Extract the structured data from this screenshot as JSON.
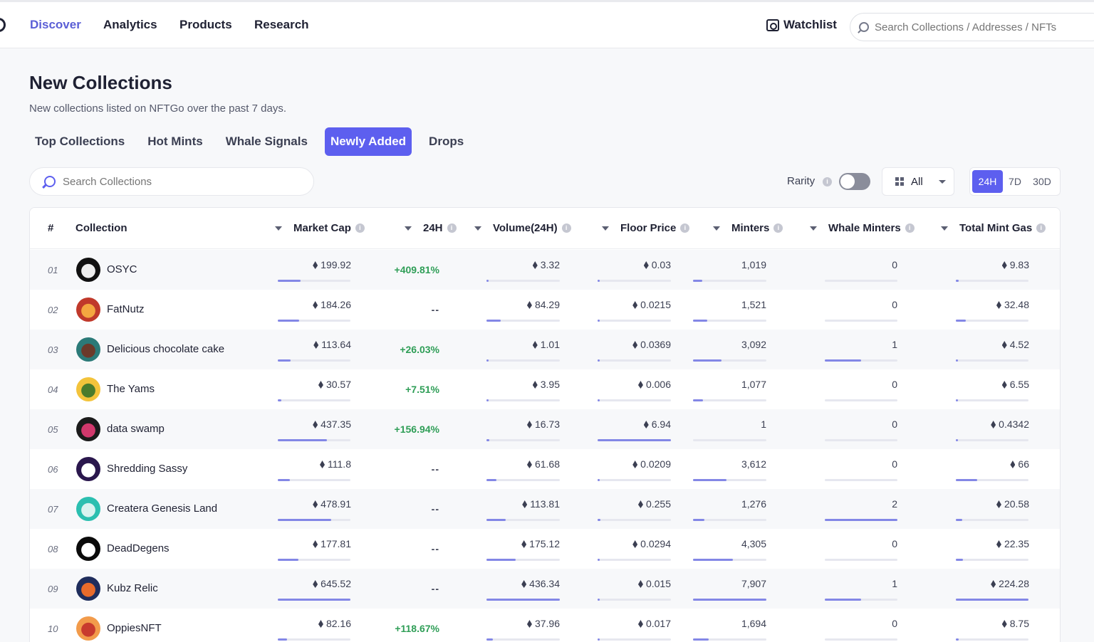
{
  "nav": {
    "items": [
      "Discover",
      "Analytics",
      "Products",
      "Research"
    ],
    "watchlist_label": "Watchlist",
    "search_placeholder": "Search Collections / Addresses / NFTs"
  },
  "page": {
    "title": "New Collections",
    "subtitle": "New collections listed on NFTGo over the past 7 days."
  },
  "tabs": [
    "Top Collections",
    "Hot Mints",
    "Whale Signals",
    "Newly Added",
    "Drops"
  ],
  "active_tab": "Newly Added",
  "toolbar": {
    "search_placeholder": "Search Collections",
    "rarity_label": "Rarity",
    "rarity_enabled": false,
    "filter_value": "All",
    "periods": [
      "24H",
      "7D",
      "30D"
    ],
    "active_period": "24H"
  },
  "table": {
    "columns": {
      "rank": "#",
      "collection": "Collection",
      "market_cap": "Market Cap",
      "change": "24H",
      "volume": "Volume(24H)",
      "floor": "Floor Price",
      "minters": "Minters",
      "whale_minters": "Whale Minters",
      "mint_gas": "Total Mint Gas"
    },
    "rows": [
      {
        "rank": "01",
        "name": "OSYC",
        "market_cap": "199.92",
        "change": "+409.81%",
        "volume": "3.32",
        "floor": "0.03",
        "minters": "1,019",
        "whale_minters": "0",
        "mint_gas": "9.83",
        "bars": {
          "market_cap": 0.31,
          "volume": 0.01,
          "floor": 0.004,
          "minters": 0.13,
          "whale_minters": 0,
          "mint_gas": 0.04
        }
      },
      {
        "rank": "02",
        "name": "FatNutz",
        "market_cap": "184.26",
        "change": "--",
        "volume": "84.29",
        "floor": "0.0215",
        "minters": "1,521",
        "whale_minters": "0",
        "mint_gas": "32.48",
        "bars": {
          "market_cap": 0.29,
          "volume": 0.19,
          "floor": 0.003,
          "minters": 0.19,
          "whale_minters": 0,
          "mint_gas": 0.14
        }
      },
      {
        "rank": "03",
        "name": "Delicious chocolate cake",
        "market_cap": "113.64",
        "change": "+26.03%",
        "volume": "1.01",
        "floor": "0.0369",
        "minters": "3,092",
        "whale_minters": "1",
        "mint_gas": "4.52",
        "bars": {
          "market_cap": 0.18,
          "volume": 0.002,
          "floor": 0.005,
          "minters": 0.39,
          "whale_minters": 0.5,
          "mint_gas": 0.02
        }
      },
      {
        "rank": "04",
        "name": "The Yams",
        "market_cap": "30.57",
        "change": "+7.51%",
        "volume": "3.95",
        "floor": "0.006",
        "minters": "1,077",
        "whale_minters": "0",
        "mint_gas": "6.55",
        "bars": {
          "market_cap": 0.05,
          "volume": 0.01,
          "floor": 0.001,
          "minters": 0.14,
          "whale_minters": 0,
          "mint_gas": 0.03
        }
      },
      {
        "rank": "05",
        "name": "data swamp",
        "market_cap": "437.35",
        "change": "+156.94%",
        "volume": "16.73",
        "floor": "6.94",
        "minters": "1",
        "whale_minters": "0",
        "mint_gas": "0.4342",
        "bars": {
          "market_cap": 0.68,
          "volume": 0.04,
          "floor": 1.0,
          "minters": 0.0,
          "whale_minters": 0,
          "mint_gas": 0.002
        }
      },
      {
        "rank": "06",
        "name": "Shredding Sassy",
        "market_cap": "111.8",
        "change": "--",
        "volume": "61.68",
        "floor": "0.0209",
        "minters": "3,612",
        "whale_minters": "0",
        "mint_gas": "66",
        "bars": {
          "market_cap": 0.17,
          "volume": 0.14,
          "floor": 0.003,
          "minters": 0.46,
          "whale_minters": 0,
          "mint_gas": 0.29
        }
      },
      {
        "rank": "07",
        "name": "Createra Genesis Land",
        "market_cap": "478.91",
        "change": "--",
        "volume": "113.81",
        "floor": "0.255",
        "minters": "1,276",
        "whale_minters": "2",
        "mint_gas": "20.58",
        "bars": {
          "market_cap": 0.74,
          "volume": 0.26,
          "floor": 0.037,
          "minters": 0.16,
          "whale_minters": 1.0,
          "mint_gas": 0.09
        }
      },
      {
        "rank": "08",
        "name": "DeadDegens",
        "market_cap": "177.81",
        "change": "--",
        "volume": "175.12",
        "floor": "0.0294",
        "minters": "4,305",
        "whale_minters": "0",
        "mint_gas": "22.35",
        "bars": {
          "market_cap": 0.28,
          "volume": 0.4,
          "floor": 0.004,
          "minters": 0.54,
          "whale_minters": 0,
          "mint_gas": 0.1
        }
      },
      {
        "rank": "09",
        "name": "Kubz Relic",
        "market_cap": "645.52",
        "change": "--",
        "volume": "436.34",
        "floor": "0.015",
        "minters": "7,907",
        "whale_minters": "1",
        "mint_gas": "224.28",
        "bars": {
          "market_cap": 1.0,
          "volume": 1.0,
          "floor": 0.002,
          "minters": 1.0,
          "whale_minters": 0.5,
          "mint_gas": 1.0
        }
      },
      {
        "rank": "10",
        "name": "OppiesNFT",
        "market_cap": "82.16",
        "change": "+118.67%",
        "volume": "37.96",
        "floor": "0.017",
        "minters": "1,694",
        "whale_minters": "0",
        "mint_gas": "8.75",
        "bars": {
          "market_cap": 0.13,
          "volume": 0.09,
          "floor": 0.002,
          "minters": 0.21,
          "whale_minters": 0,
          "mint_gas": 0.04
        }
      }
    ]
  },
  "colors": {
    "accent": "#5d5fef",
    "positive": "#2f9e57",
    "bar": "#8387e6"
  }
}
